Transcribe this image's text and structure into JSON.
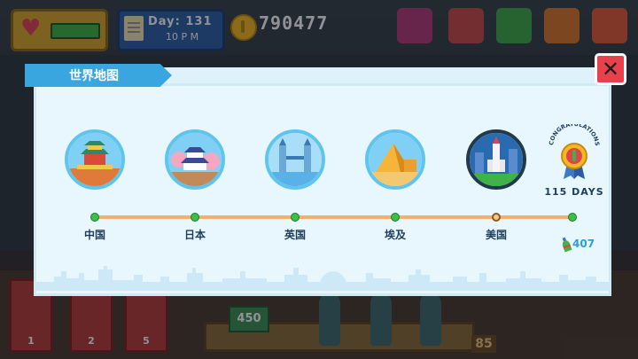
{
  "hud": {
    "day_label": "Day: 131",
    "time_label": "10 P M",
    "money": "790477"
  },
  "slots": [
    {
      "label": "1"
    },
    {
      "label": "2"
    },
    {
      "label": "5"
    }
  ],
  "scene_badges": {
    "left": "450",
    "right": "85"
  },
  "modal": {
    "title": "世界地图",
    "close_symbol": "✕",
    "regions": [
      {
        "label": "中国",
        "state": "completed"
      },
      {
        "label": "日本",
        "state": "completed"
      },
      {
        "label": "英国",
        "state": "completed"
      },
      {
        "label": "埃及",
        "state": "completed"
      },
      {
        "label": "美国",
        "state": "current"
      }
    ],
    "reward": {
      "banner_text": "CONGRATULATIONS!",
      "days_label": "115 DAYS",
      "bottle_count": "407"
    }
  },
  "colors": {
    "accent": "#3aa6e0",
    "progress_line": "#f0b070",
    "completed_dot": "#37c14a",
    "close_button": "#e9414c"
  },
  "icons": {
    "health": "heart-icon",
    "day": "calendar-note-icon",
    "money": "coin-icon",
    "close": "close-icon",
    "reward": "medal-icon",
    "bottles": "bottle-icon"
  }
}
